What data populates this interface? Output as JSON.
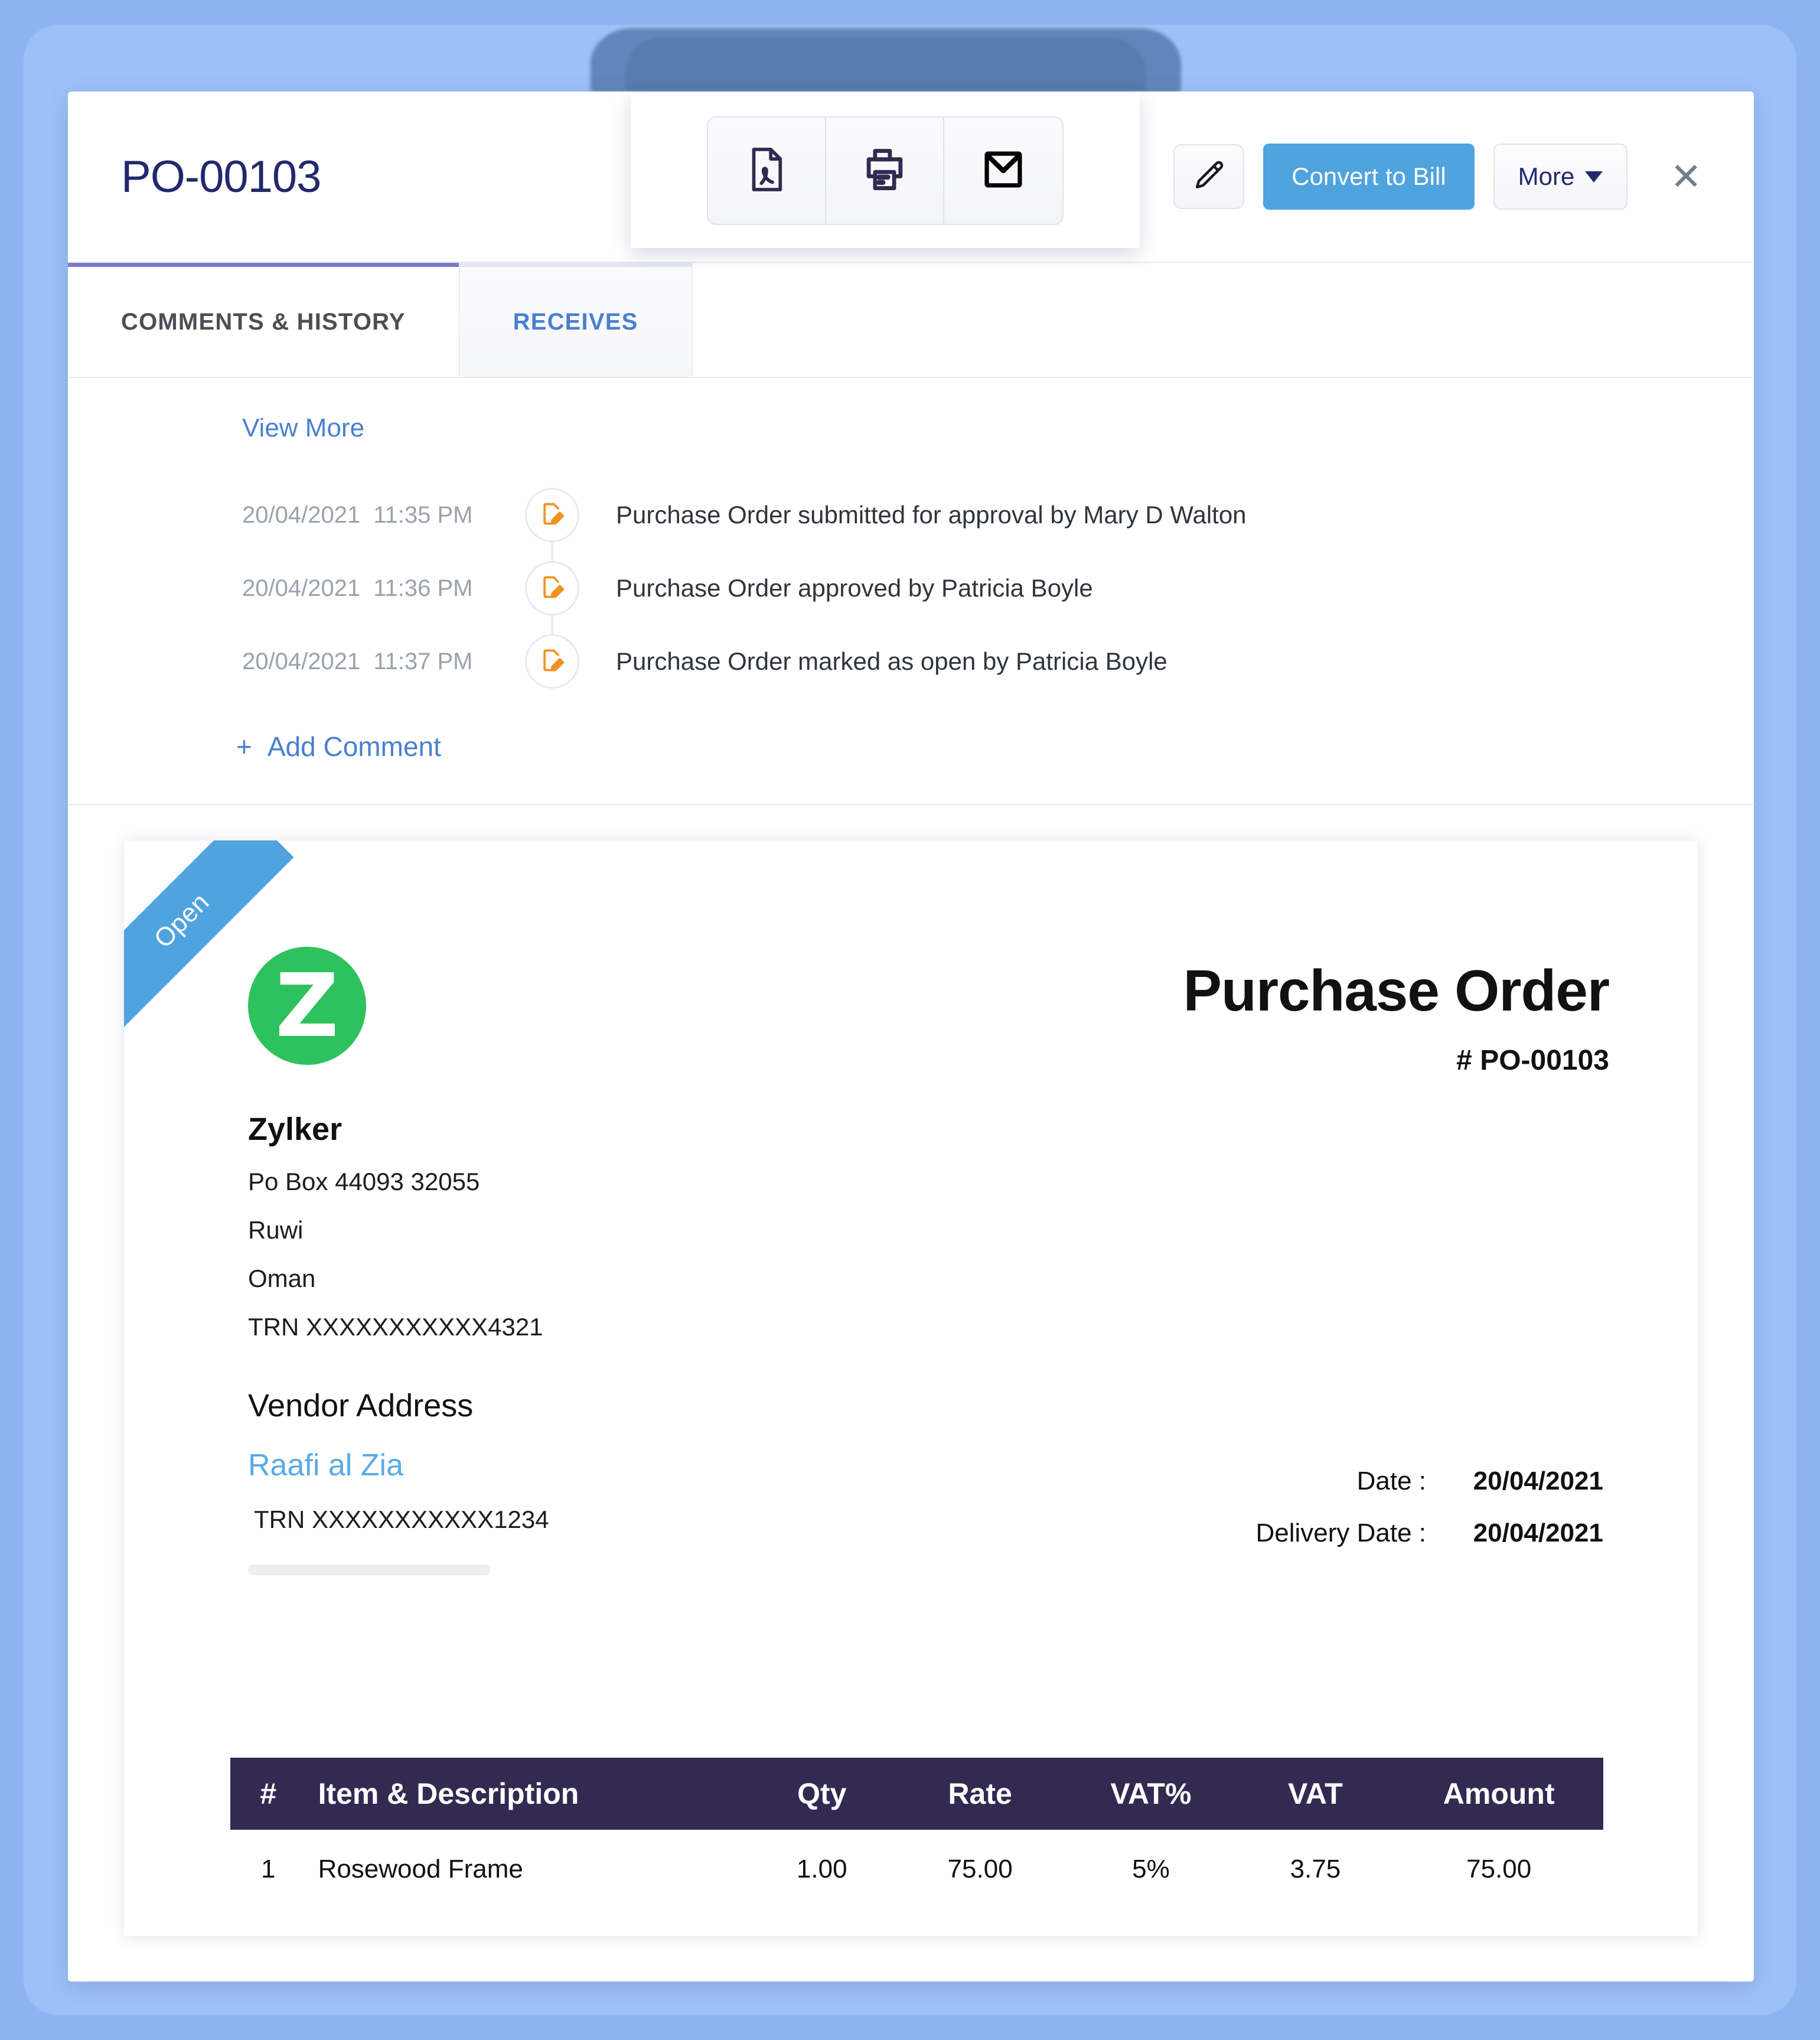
{
  "window": {
    "title": "PO-00103",
    "close_label": "✕"
  },
  "header": {
    "edit_icon": "pencil-icon",
    "convert_label": "Convert to Bill",
    "more_label": "More"
  },
  "share_popup": {
    "buttons": [
      {
        "icon": "pdf-file-icon",
        "name": "export-pdf"
      },
      {
        "icon": "printer-icon",
        "name": "print"
      },
      {
        "icon": "envelope-icon",
        "name": "email"
      }
    ]
  },
  "tabs": [
    {
      "label": "COMMENTS & HISTORY",
      "active": true
    },
    {
      "label": "RECEIVES",
      "active": false
    }
  ],
  "history": {
    "view_more_label": "View More",
    "add_comment_label": "Add Comment",
    "add_comment_plus": "+",
    "entries": [
      {
        "date": "20/04/2021",
        "time": "11:35 PM",
        "text": "Purchase Order submitted for approval by Mary D Walton"
      },
      {
        "date": "20/04/2021",
        "time": "11:36 PM",
        "text": "Purchase Order approved by Patricia Boyle"
      },
      {
        "date": "20/04/2021",
        "time": "11:37 PM",
        "text": "Purchase Order marked as open by Patricia Boyle"
      }
    ]
  },
  "document": {
    "ribbon_label": "Open",
    "logo_letter": "Z",
    "title": "Purchase Order",
    "number": "# PO-00103",
    "company_name": "Zylker",
    "company_address": [
      "Po Box 44093 32055",
      "Ruwi",
      "Oman",
      "TRN XXXXXXXXXXX4321"
    ],
    "vendor_heading": "Vendor Address",
    "vendor_name": "Raafi al Zia",
    "vendor_trn": "TRN XXXXXXXXXXX1234",
    "dates": [
      {
        "label": "Date :",
        "value": "20/04/2021"
      },
      {
        "label": "Delivery Date :",
        "value": "20/04/2021"
      }
    ],
    "table": {
      "headers": [
        "#",
        "Item & Description",
        "Qty",
        "Rate",
        "VAT%",
        "VAT",
        "Amount"
      ],
      "rows": [
        {
          "idx": "1",
          "item": "Rosewood Frame",
          "qty": "1.00",
          "rate": "75.00",
          "vat_percent": "5%",
          "vat": "3.75",
          "amount": "75.00"
        }
      ]
    }
  },
  "colors": {
    "background_blue": "#8db4f2",
    "inner_band_blue": "#9dc0f7",
    "accent_blue": "#4fa3de",
    "title_navy": "#22296b",
    "link_blue": "#4a80cf",
    "table_header": "#332a51",
    "logo_green": "#2ec25e",
    "tab_active_border": "#7b79c7",
    "timeline_orange": "#f0921f"
  }
}
